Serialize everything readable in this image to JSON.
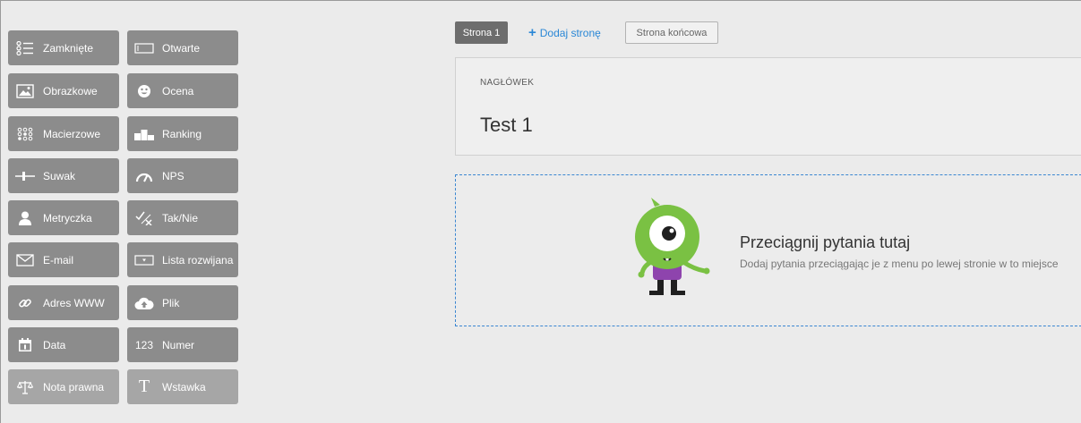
{
  "palette": [
    {
      "label": "Zamknięte",
      "icon": "closed-question-icon"
    },
    {
      "label": "Otwarte",
      "icon": "open-question-icon"
    },
    {
      "label": "Obrazkowe",
      "icon": "image-icon"
    },
    {
      "label": "Ocena",
      "icon": "smiley-icon"
    },
    {
      "label": "Macierzowe",
      "icon": "matrix-icon"
    },
    {
      "label": "Ranking",
      "icon": "podium-icon"
    },
    {
      "label": "Suwak",
      "icon": "slider-icon"
    },
    {
      "label": "NPS",
      "icon": "gauge-icon"
    },
    {
      "label": "Metryczka",
      "icon": "person-icon"
    },
    {
      "label": "Tak/Nie",
      "icon": "yes-no-icon"
    },
    {
      "label": "E-mail",
      "icon": "envelope-icon"
    },
    {
      "label": "Lista rozwijana",
      "icon": "dropdown-icon"
    },
    {
      "label": "Adres WWW",
      "icon": "link-icon"
    },
    {
      "label": "Plik",
      "icon": "cloud-upload-icon"
    },
    {
      "label": "Data",
      "icon": "calendar-icon"
    },
    {
      "label": "Numer",
      "icon": "number-icon",
      "icon_text": "123"
    },
    {
      "label": "Nota prawna",
      "icon": "scales-icon"
    },
    {
      "label": "Wstawka",
      "icon": "text-insert-icon",
      "icon_text": "T"
    }
  ],
  "pages": {
    "active_tab": "Strona 1",
    "add_page": "Dodaj stronę",
    "end_page": "Strona końcowa"
  },
  "header": {
    "caption": "NAGŁÓWEK",
    "title": "Test 1"
  },
  "dropzone": {
    "title": "Przeciągnij pytania tutaj",
    "subtitle": "Dodaj pytania przeciągając je z menu po lewej stronie w to miejsce"
  },
  "colors": {
    "button_bg": "#8c8c8c",
    "accent_blue": "#2a87d6",
    "mascot_green": "#7ac143",
    "mascot_purple": "#8e44ad"
  }
}
